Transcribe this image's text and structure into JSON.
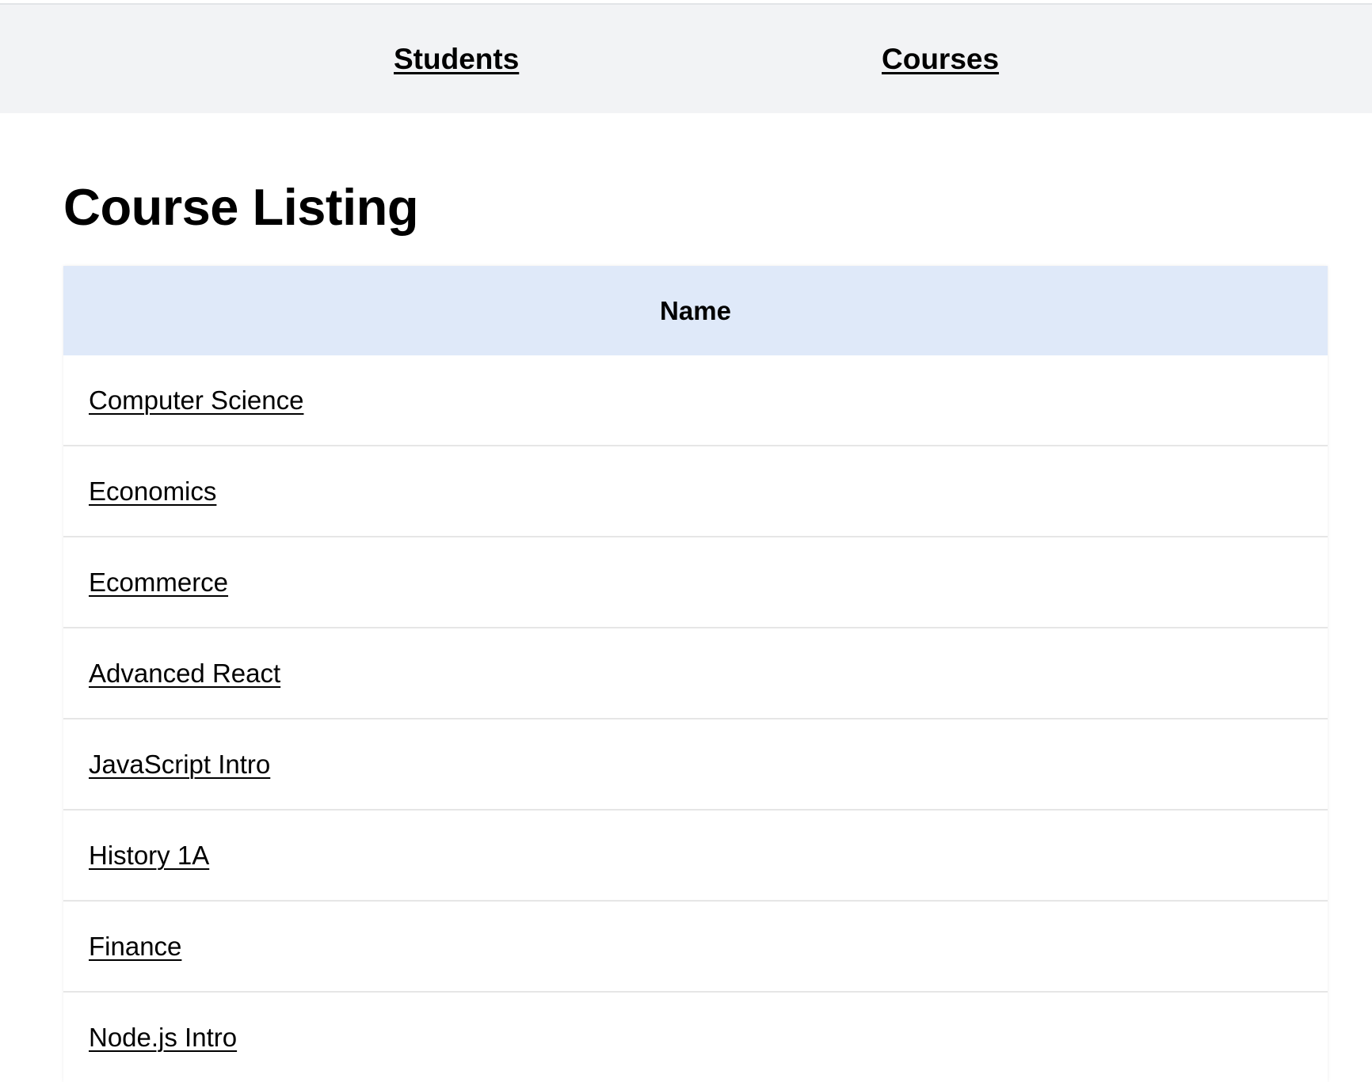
{
  "nav": {
    "students_label": "Students",
    "courses_label": "Courses"
  },
  "main": {
    "title": "Course Listing",
    "table": {
      "columns": [
        "Name"
      ],
      "rows": [
        {
          "name": "Computer Science"
        },
        {
          "name": "Economics"
        },
        {
          "name": "Ecommerce"
        },
        {
          "name": "Advanced React"
        },
        {
          "name": "JavaScript Intro"
        },
        {
          "name": "History 1A"
        },
        {
          "name": "Finance"
        },
        {
          "name": "Node.js Intro"
        }
      ]
    }
  },
  "colors": {
    "nav_background": "#f2f3f5",
    "table_header_background": "#dfe9f9"
  }
}
